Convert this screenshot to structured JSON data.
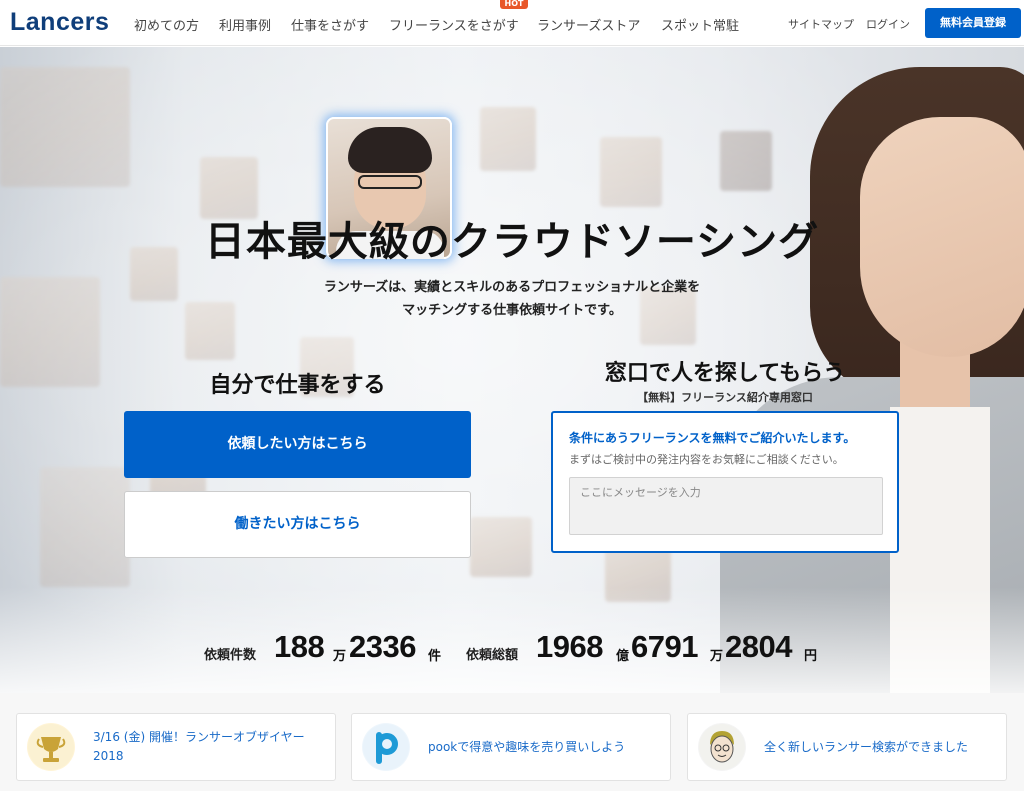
{
  "header": {
    "logo": "Lancers",
    "nav": [
      {
        "label": "初めての方"
      },
      {
        "label": "利用事例"
      },
      {
        "label": "仕事をさがす"
      },
      {
        "label": "フリーランスをさがす",
        "badge": "HOT"
      },
      {
        "label": "ランサーズストア"
      },
      {
        "label": "スポット常駐"
      }
    ],
    "util": [
      {
        "label": "サイトマップ"
      },
      {
        "label": "ログイン"
      }
    ],
    "signup_label": "無料会員登録",
    "accent_color": "#0061c9"
  },
  "hero": {
    "title": "日本最大級のクラウドソーシング",
    "subtitle_line1": "ランサーズは、実績とスキルのあるプロフェッショナルと企業を",
    "subtitle_line2": "マッチングする仕事依頼サイトです。",
    "left": {
      "heading": "自分で仕事をする",
      "client_button": "依頼したい方はこちら",
      "worker_button": "働きたい方はこちら"
    },
    "right": {
      "heading": "窓口で人を探してもらう",
      "small": "【無料】フリーランス紹介専用窓口",
      "lead": "条件にあうフリーランスを無料でご紹介いたします。",
      "desc": "まずはご検討中の発注内容をお気軽にご相談ください。",
      "placeholder": "ここにメッセージを入力"
    },
    "stats": {
      "requests_label": "依頼件数",
      "requests_num1": "188",
      "requests_unit1": "万",
      "requests_num2": "2336",
      "requests_unit2": "件",
      "total_label": "依頼総額",
      "total_num1": "1968",
      "total_unit1": "億",
      "total_num2": "6791",
      "total_unit2": "万",
      "total_num3": "2804",
      "total_unit3": "円"
    }
  },
  "news": [
    {
      "icon": "trophy-icon",
      "text": "3/16 (金) 開催！ランサーオブザイヤー2018"
    },
    {
      "icon": "pook-logo-icon",
      "text": "pookで得意や趣味を売り買いしよう"
    },
    {
      "icon": "person-avatar-icon",
      "text": "全く新しいランサー検索ができました"
    }
  ]
}
